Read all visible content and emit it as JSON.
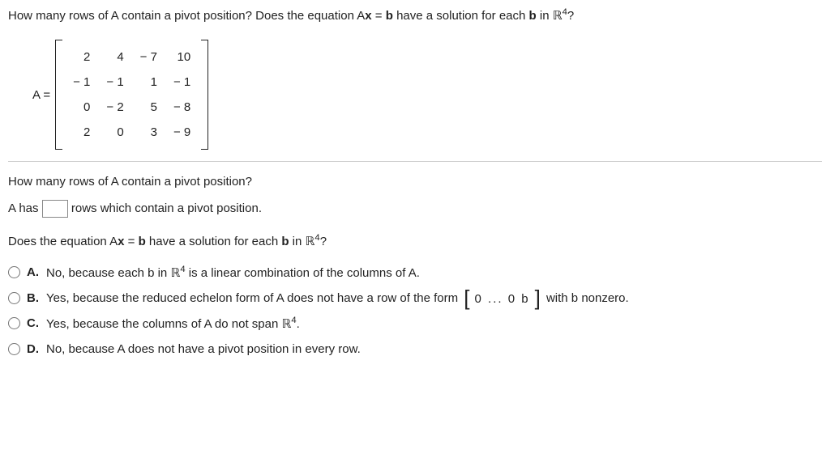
{
  "header": {
    "text_a": "How many rows of A contain a pivot position? Does the equation A",
    "text_b": " have a solution for each ",
    "bold_x": "x",
    "eq": " = ",
    "bold_b": "b",
    "in_txt": " in ",
    "R": "ℝ",
    "sup": "4",
    "q": "?"
  },
  "matrix": {
    "label": "A =",
    "rows": [
      [
        "2",
        "4",
        "− 7",
        "10"
      ],
      [
        "− 1",
        "− 1",
        "1",
        "− 1"
      ],
      [
        "0",
        "− 2",
        "5",
        "− 8"
      ],
      [
        "2",
        "0",
        "3",
        "− 9"
      ]
    ]
  },
  "subq1": "How many rows of A contain a pivot position?",
  "fill": {
    "pre": "A has ",
    "value": "",
    "post": " rows which contain a pivot position."
  },
  "subq2": {
    "a": "Does the equation A",
    "bold_x": "x",
    "eq": " = ",
    "bold_b": "b",
    "b": " have a solution for each ",
    "in_txt": " in ",
    "R": "ℝ",
    "sup": "4",
    "q": "?"
  },
  "choices": [
    {
      "label": "A.",
      "pre": "No, because each b in ",
      "R": "ℝ",
      "sup": "4",
      "post": " is a linear combination of the columns of A."
    },
    {
      "label": "B.",
      "pre": "Yes, because the reduced echelon form of A does not have a row of the form ",
      "rowvec": "0  ...  0  b",
      "post": " with b nonzero."
    },
    {
      "label": "C.",
      "pre": "Yes, because the columns of A do not span ",
      "R": "ℝ",
      "sup": "4",
      "post": "."
    },
    {
      "label": "D.",
      "pre": "No, because A does not have a pivot position in every row.",
      "post": ""
    }
  ]
}
